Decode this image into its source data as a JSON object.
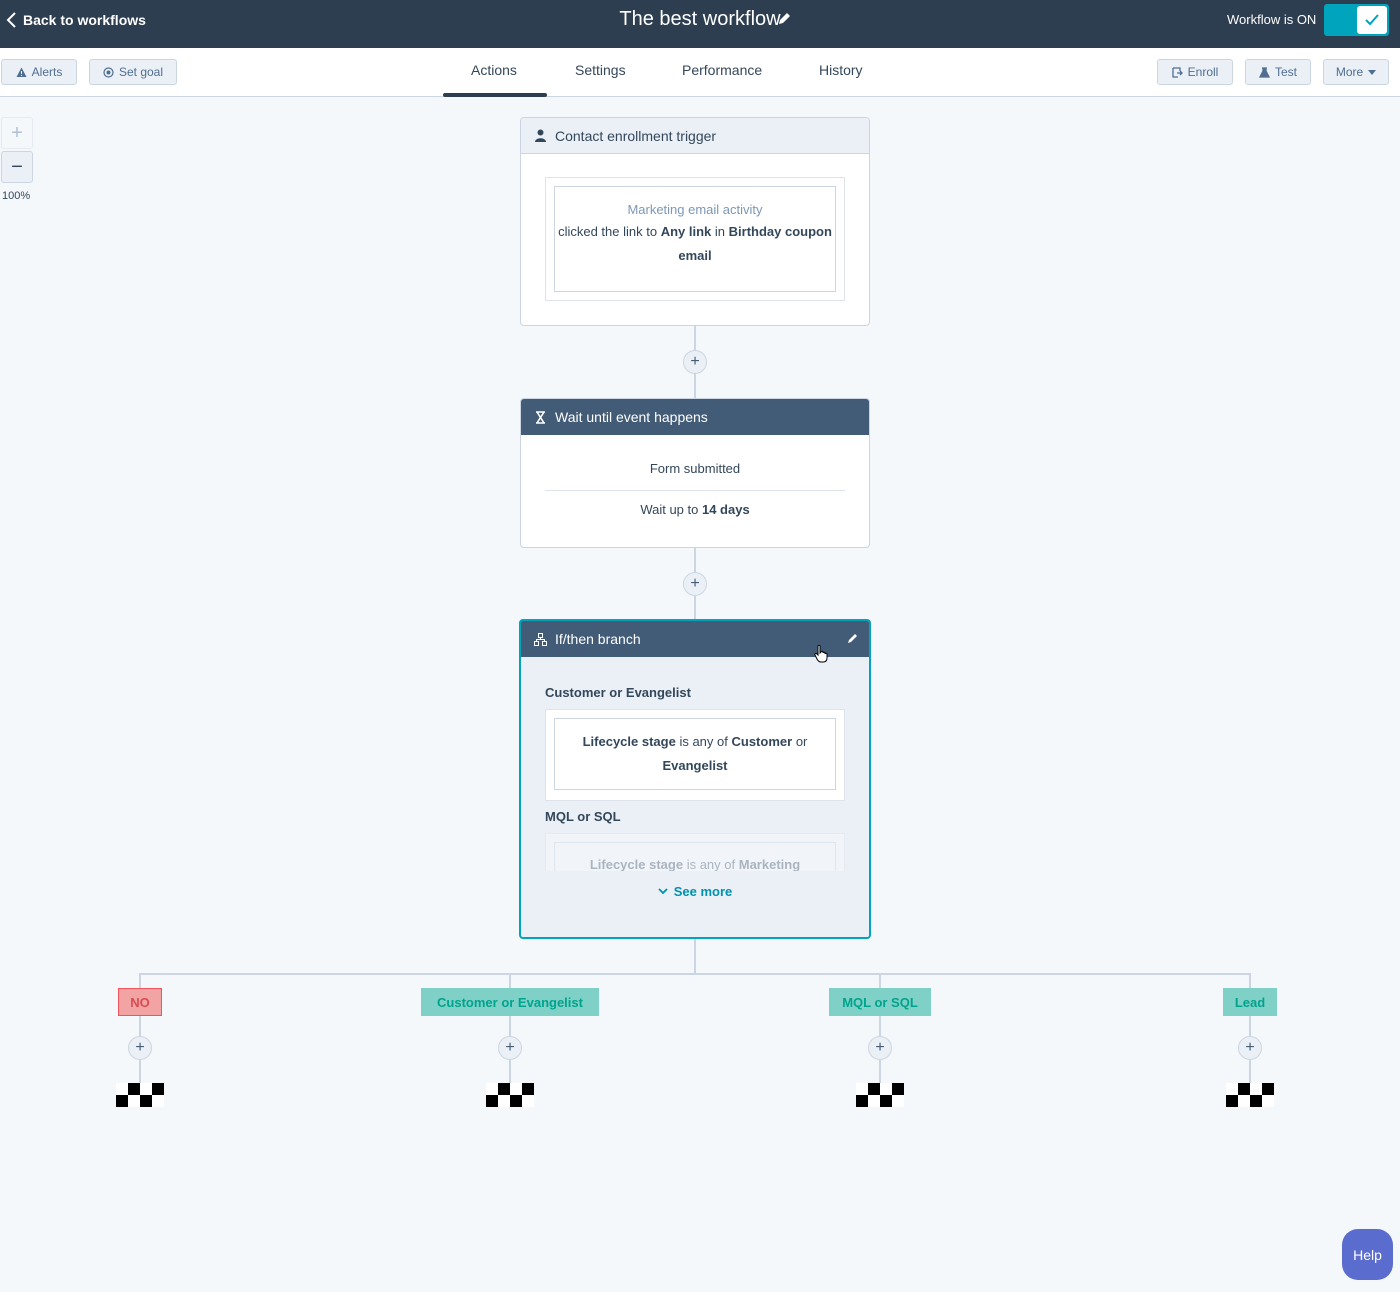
{
  "header": {
    "back_label": "Back to workflows",
    "workflow_title": "The best workflow",
    "status_label": "Workflow is ON",
    "toggle_on": true
  },
  "toolbar": {
    "alerts_label": "Alerts",
    "set_goal_label": "Set goal",
    "tabs": [
      {
        "label": "Actions",
        "active": true
      },
      {
        "label": "Settings",
        "active": false
      },
      {
        "label": "Performance",
        "active": false
      },
      {
        "label": "History",
        "active": false
      }
    ],
    "enroll_label": "Enroll",
    "test_label": "Test",
    "more_label": "More"
  },
  "zoom": {
    "in_symbol": "+",
    "out_symbol": "−",
    "level": "100%"
  },
  "trigger_card": {
    "title": "Contact enrollment trigger",
    "filter_category": "Marketing email activity",
    "filter_prefix": "clicked the link to",
    "filter_link": "Any link",
    "filter_in": "in",
    "filter_email": "Birthday coupon email"
  },
  "wait_card": {
    "title": "Wait until event happens",
    "event": "Form submitted",
    "wait_prefix": "Wait up to",
    "wait_value": "14 days"
  },
  "branch_card": {
    "title": "If/then branch",
    "branch1_name": "Customer or Evangelist",
    "branch1_property": "Lifecycle stage",
    "branch1_operator": "is any of",
    "branch1_value1": "Customer",
    "branch1_or": "or",
    "branch1_value2": "Evangelist",
    "branch2_name": "MQL or SQL",
    "branch2_property": "Lifecycle stage",
    "branch2_operator": "is any of",
    "branch2_value": "Marketing",
    "see_more_label": "See more"
  },
  "branches": [
    {
      "label": "NO",
      "type": "no"
    },
    {
      "label": "Customer or Evangelist",
      "type": "yes"
    },
    {
      "label": "MQL or SQL",
      "type": "yes"
    },
    {
      "label": "Lead",
      "type": "yes"
    }
  ],
  "plus_symbol": "+",
  "help_label": "Help",
  "colors": {
    "header_bg": "#2d3e50",
    "accent": "#00a4bd",
    "branch_label_bg": "#7fd1c7",
    "no_label_bg": "#f2a3a3",
    "help_bg": "#5b6ccf"
  }
}
